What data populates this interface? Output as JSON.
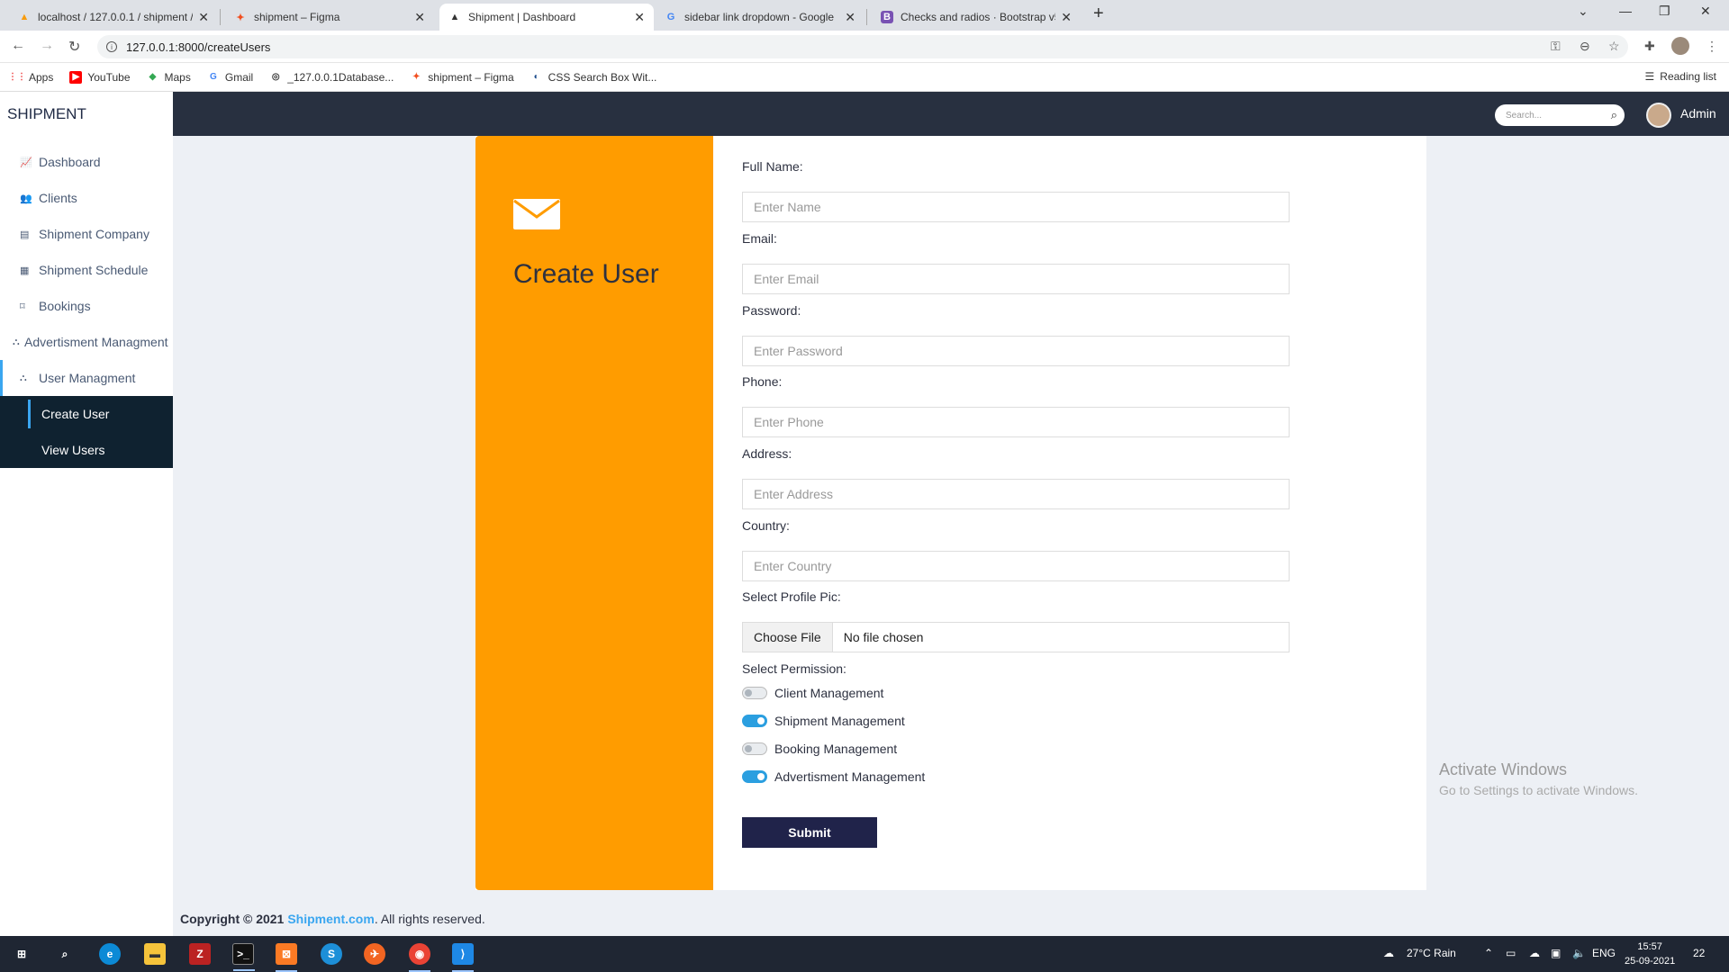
{
  "browser": {
    "tabs": [
      {
        "label": "localhost / 127.0.0.1 / shipment /",
        "icon": "phpmyadmin-icon"
      },
      {
        "label": "shipment – Figma",
        "icon": "figma-icon"
      },
      {
        "label": "Shipment | Dashboard",
        "icon": "app-icon"
      },
      {
        "label": "sidebar link dropdown - Google",
        "icon": "google-icon"
      },
      {
        "label": "Checks and radios · Bootstrap v5",
        "icon": "bootstrap-icon"
      }
    ],
    "url": "127.0.0.1:8000/createUsers",
    "bookmarks": [
      "Apps",
      "YouTube",
      "Maps",
      "Gmail",
      "_127.0.0.1Database...",
      "shipment – Figma",
      "CSS Search Box Wit..."
    ],
    "reading_list": "Reading list"
  },
  "app": {
    "brand": "SHIPMENT",
    "sidebar": {
      "items": [
        {
          "label": "Dashboard",
          "icon": "chart-icon"
        },
        {
          "label": "Clients",
          "icon": "users-icon"
        },
        {
          "label": "Shipment Company",
          "icon": "building-icon"
        },
        {
          "label": "Shipment Schedule",
          "icon": "calendar-icon"
        },
        {
          "label": "Bookings",
          "icon": "bookmark-icon"
        },
        {
          "label": "Advertisment Managment",
          "icon": "sitemap-icon"
        },
        {
          "label": "User Managment",
          "icon": "sitemap-icon"
        }
      ],
      "submenu": [
        {
          "label": "Create User"
        },
        {
          "label": "View Users"
        }
      ]
    },
    "topbar": {
      "search_placeholder": "Search...",
      "user": "Admin"
    },
    "card": {
      "title": "Create User",
      "accent": "#ff9c00"
    },
    "form": {
      "full_name": {
        "label": "Full Name:",
        "placeholder": "Enter Name"
      },
      "email": {
        "label": "Email:",
        "placeholder": "Enter Email"
      },
      "password": {
        "label": "Password:",
        "placeholder": "Enter Password"
      },
      "phone": {
        "label": "Phone:",
        "placeholder": "Enter Phone"
      },
      "address": {
        "label": "Address:",
        "placeholder": "Enter Address"
      },
      "country": {
        "label": "Country:",
        "placeholder": "Enter Country"
      },
      "profile_pic": {
        "label": "Select Profile Pic:",
        "button": "Choose File",
        "value": "No file chosen"
      },
      "permissions": {
        "label": "Select Permission:",
        "items": [
          {
            "label": "Client Management",
            "checked": false
          },
          {
            "label": "Shipment Management",
            "checked": true
          },
          {
            "label": "Booking Management",
            "checked": false
          },
          {
            "label": "Advertisment Management",
            "checked": true
          }
        ]
      },
      "submit": "Submit"
    },
    "footer": {
      "prefix": "Copyright © 2021",
      "link": "Shipment.com",
      "suffix": ". All rights reserved."
    }
  },
  "watermark": {
    "title": "Activate Windows",
    "subtitle": "Go to Settings to activate Windows."
  },
  "taskbar": {
    "weather": "27°C  Rain",
    "lang": "ENG",
    "time": "15:57",
    "date": "25-09-2021",
    "notifications": "22"
  }
}
